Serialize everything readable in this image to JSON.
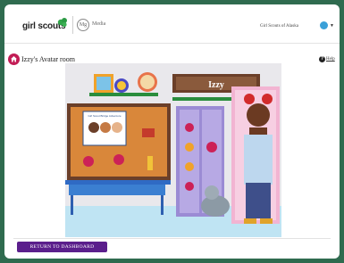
{
  "header": {
    "logo_text": "girl scouts",
    "media_badge": "Mg",
    "media_label": "Media",
    "council_name": "Girl Scouts of Alaska"
  },
  "page": {
    "title": "Izzy's Avatar room",
    "help_icon_glyph": "?",
    "help_label": "Help"
  },
  "room": {
    "nameplate": "Izzy",
    "poster_text": "Girl Scout Bridge Adventure"
  },
  "footer": {
    "return_label": "RETURN TO DASHBOARD"
  },
  "colors": {
    "brand_green": "#2f6b4f",
    "accent_magenta": "#c21c55",
    "button_purple": "#5b1f8c"
  },
  "icons": [
    "trefoil-icon",
    "home-icon",
    "help-icon",
    "user-avatar-icon",
    "chevron-down-icon"
  ]
}
